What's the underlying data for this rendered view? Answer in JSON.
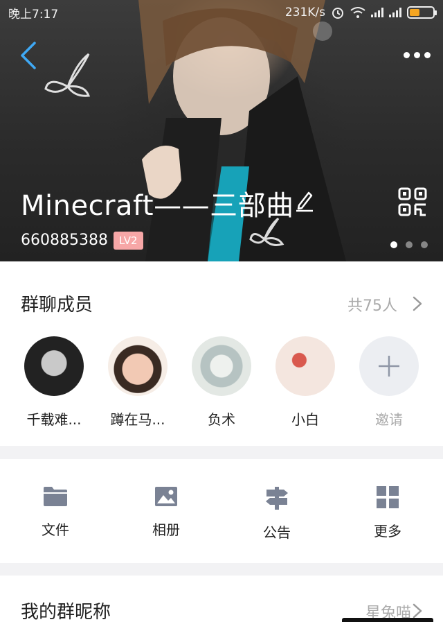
{
  "status_bar": {
    "time": "晚上7:17",
    "network_speed": "231K/s"
  },
  "group": {
    "name": "Minecraft——三部曲",
    "id": "660885388",
    "level": "LV2"
  },
  "members_section": {
    "title": "群聊成员",
    "count_text": "共75人",
    "members": [
      {
        "name": "千载难..."
      },
      {
        "name": "蹲在马..."
      },
      {
        "name": "负术"
      },
      {
        "name": "小白"
      }
    ],
    "invite_label": "邀请"
  },
  "tools": [
    {
      "label": "文件",
      "icon": "folder-icon"
    },
    {
      "label": "相册",
      "icon": "image-icon"
    },
    {
      "label": "公告",
      "icon": "signpost-icon"
    },
    {
      "label": "更多",
      "icon": "grid-icon"
    }
  ],
  "nickname": {
    "title": "我的群昵称",
    "value": "星兔喵"
  },
  "colors": {
    "accent": "#3fa9f5",
    "level_badge": "#f7a7a7",
    "icon_gray": "#7a8294",
    "muted_text": "#aaaaaa"
  }
}
